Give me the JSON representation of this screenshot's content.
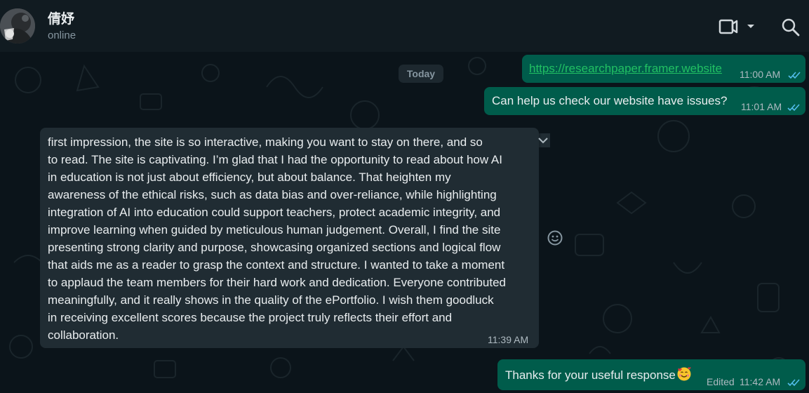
{
  "header": {
    "contact_name": "倩妤",
    "status": "online",
    "icons": [
      "avatar",
      "video-call-icon",
      "dropdown-chevron-icon",
      "search-icon"
    ]
  },
  "chat": {
    "date_label": "Today",
    "messages": [
      {
        "direction": "outgoing",
        "text": "https://researchpaper.framer.website",
        "time": "11:00 AM",
        "status": "read"
      },
      {
        "direction": "outgoing",
        "text": "Can help us check our website have issues?",
        "time": "11:01 AM",
        "status": "read"
      },
      {
        "direction": "incoming",
        "lines": [
          "first impression, the site is so interactive, making you want to stay on there, and so",
          "to read. The site is captivating. I’m glad that I had the opportunity to read about how AI",
          "in education is not just about efficiency, but about balance. That heighten my",
          "awareness of the ethical risks, such as data bias and over-reliance, while highlighting",
          "integration of AI into education could support teachers, protect academic integrity, and",
          "improve learning when guided by meticulous human judgement. Overall, I find the site",
          "presenting strong clarity and purpose, showcasing organized sections and logical flow",
          "that aids me as a reader to grasp the context and structure. I wanted to take a moment",
          "to applaud the team members for their hard work and dedication. Everyone contributed",
          "meaningfully, and it really shows in the quality of the ePortfolio. I wish them goodluck",
          "in receiving excellent scores because the project truly reflects their effort and",
          "collaboration."
        ],
        "time": "11:39 AM"
      },
      {
        "direction": "outgoing",
        "text": "Thanks for your useful response",
        "emoji": "smiling-face-with-hearts",
        "edited_label": "Edited",
        "time": "11:42 AM",
        "status": "read"
      }
    ]
  },
  "colors": {
    "header_bg": "#111b21",
    "chat_bg": "#0b141a",
    "outgoing_bubble": "#005c4b",
    "incoming_bubble": "#202c33",
    "read_ticks": "#53bdeb",
    "link": "#21c063"
  }
}
